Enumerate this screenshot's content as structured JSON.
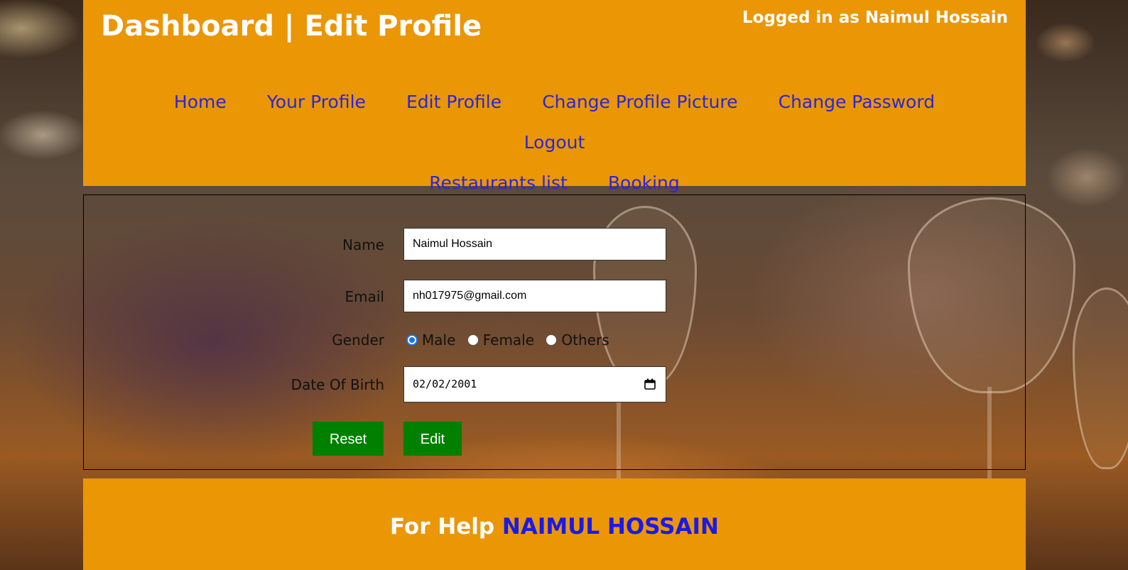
{
  "header": {
    "title": "Dashboard | Edit Profile",
    "logged_in": "Logged in as Naimul Hossain"
  },
  "nav": {
    "items": [
      {
        "label": "Home"
      },
      {
        "label": "Your Profile"
      },
      {
        "label": "Edit Profile"
      },
      {
        "label": "Change Profile Picture"
      },
      {
        "label": "Change Password"
      },
      {
        "label": "Logout"
      },
      {
        "label": "Restaurants list"
      },
      {
        "label": "Booking"
      }
    ]
  },
  "form": {
    "name_label": "Name",
    "name_value": "Naimul Hossain",
    "email_label": "Email",
    "email_value": "nh017975@gmail.com",
    "gender_label": "Gender",
    "gender_options": [
      "Male",
      "Female",
      "Others"
    ],
    "gender_selected": "Male",
    "dob_label": "Date Of Birth",
    "dob_value": "02/02/2001",
    "reset_label": "Reset",
    "edit_label": "Edit"
  },
  "footer": {
    "help_text": "For Help",
    "help_name": "NAIMUL HOSSAIN"
  },
  "colors": {
    "header_bg": "#eb9605",
    "link": "#2a26d8",
    "button_bg": "#008000",
    "footer_name": "#1a1ae6"
  },
  "icons": {
    "calendar": "calendar-icon"
  }
}
